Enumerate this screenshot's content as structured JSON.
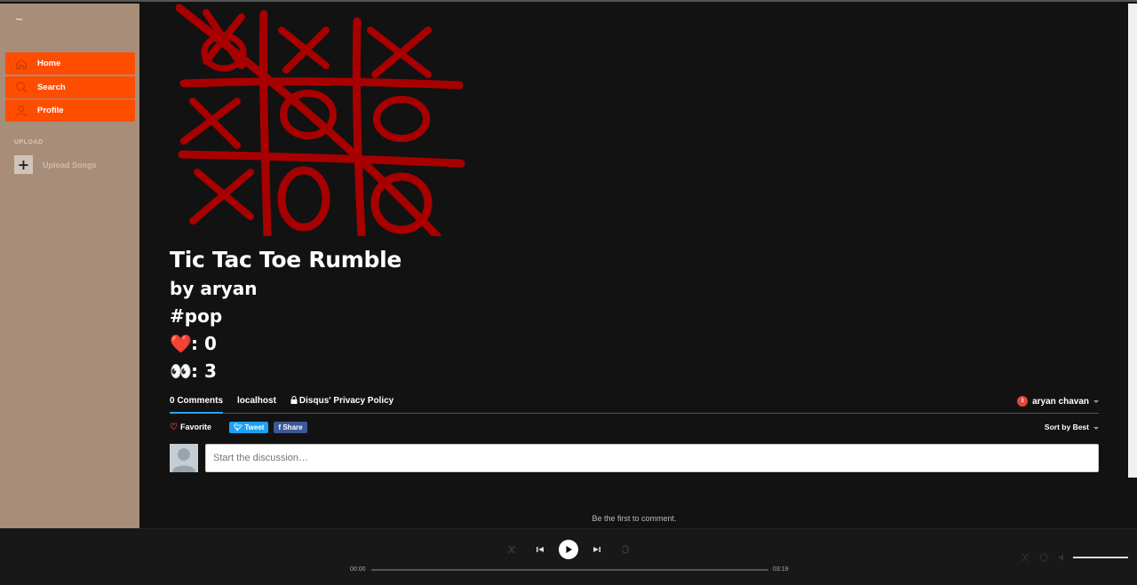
{
  "sidebar": {
    "logo": "~",
    "items": [
      {
        "label": "Home",
        "icon": "home-icon"
      },
      {
        "label": "Search",
        "icon": "search-icon"
      },
      {
        "label": "Profile",
        "icon": "user-icon"
      }
    ],
    "section_label": "UPLOAD",
    "upload_label": "Upload Songs"
  },
  "song": {
    "title": "Tic Tac Toe Rumble",
    "artist": "by aryan",
    "tag": "#pop",
    "likes_emoji": "❤️",
    "likes": ": 0",
    "views_emoji": "👀",
    "views": ": 3"
  },
  "disqus": {
    "tabs": [
      "0 Comments",
      "localhost",
      "Disqus' Privacy Policy"
    ],
    "user_name": "aryan chavan",
    "notification_count": "3",
    "favorite_label": "Favorite",
    "tweet_label": "Tweet",
    "share_label": "Share",
    "sort_label": "Sort by Best",
    "compose_placeholder": "Start the discussion…",
    "first_comment": "Be the first to comment."
  },
  "player": {
    "current_time": "00:00",
    "duration": "03:19",
    "progress": 0.0,
    "volume": 1.0
  },
  "colors": {
    "sidebar_bg": "#a88d78",
    "nav_accent": "#ff4d00",
    "main_bg": "#121212",
    "player_bg": "#181818",
    "cover_red": "#a80000"
  }
}
